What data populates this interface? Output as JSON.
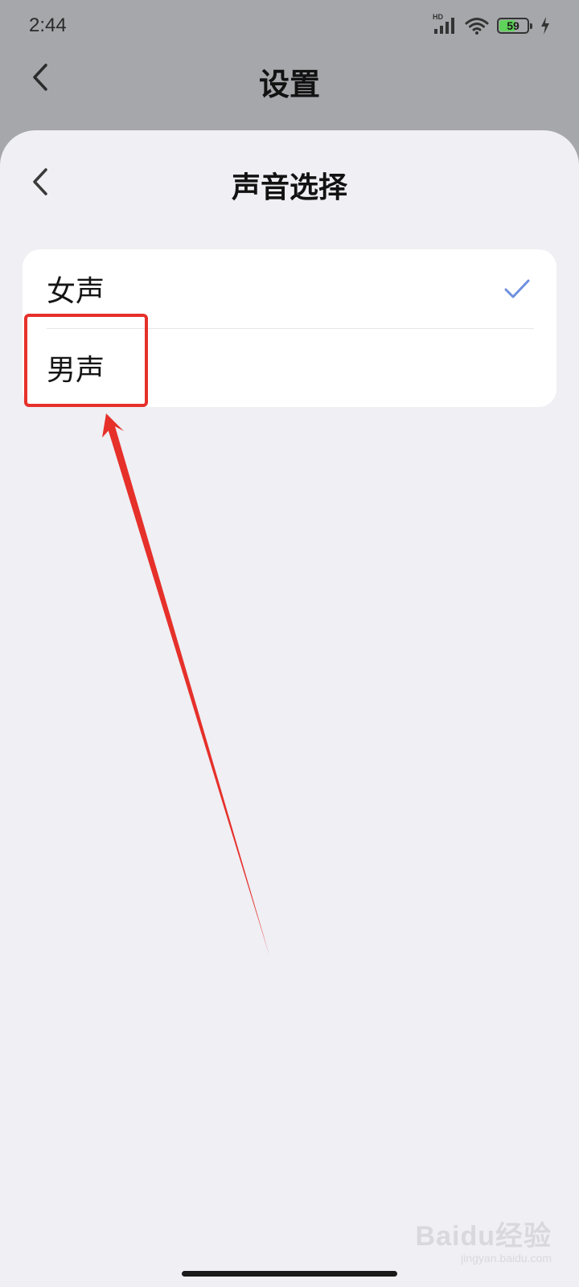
{
  "status_bar": {
    "time": "2:44",
    "network_label": "HD",
    "battery_level": "59",
    "battery_fraction": 0.59,
    "icons": [
      "signal-icon",
      "wifi-icon",
      "battery-icon",
      "charging-icon"
    ]
  },
  "background_header": {
    "title": "设置"
  },
  "sheet": {
    "title": "声音选择",
    "options": [
      {
        "label": "女声",
        "selected": true
      },
      {
        "label": "男声",
        "selected": false
      }
    ]
  },
  "watermark": {
    "brand": "Baidu经验",
    "sub": "jingyan.baidu.com"
  },
  "colors": {
    "accent_check": "#6f8fe0",
    "annotation_red": "#e6302a",
    "sheet_background": "#efeff4",
    "dim_background": "#a6a7ab"
  }
}
